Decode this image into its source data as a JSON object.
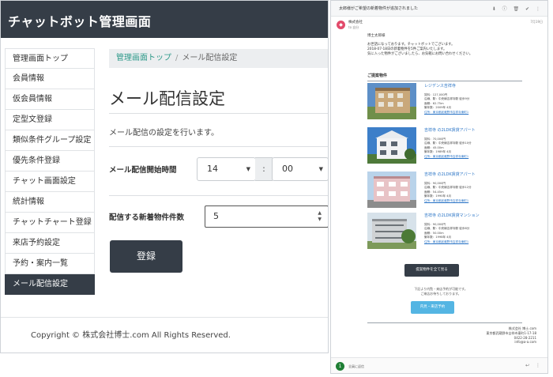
{
  "admin": {
    "title": "チャットボット管理画面",
    "sidebar": {
      "items": [
        {
          "label": "管理画面トップ"
        },
        {
          "label": "会員情報"
        },
        {
          "label": "仮会員情報"
        },
        {
          "label": "定型文登録"
        },
        {
          "label": "類似条件グループ設定"
        },
        {
          "label": "優先条件登録"
        },
        {
          "label": "チャット画面設定"
        },
        {
          "label": "統計情報"
        },
        {
          "label": "チャットチャート登録"
        },
        {
          "label": "来店予約設定"
        },
        {
          "label": "予約・案内一覧"
        },
        {
          "label": "メール配信設定"
        }
      ],
      "active_index": 11
    },
    "breadcrumb": {
      "home": "管理画面トップ",
      "separator": "/",
      "current": "メール配信設定"
    },
    "page_title": "メール配信設定",
    "description": "メール配信の設定を行います。",
    "form": {
      "start_time_label": "メール配信開始時間",
      "hour": "14",
      "colon": ":",
      "minute": "00",
      "count_label": "配信する新着物件件数",
      "count_value": "5"
    },
    "register_button": "登録",
    "copyright": "Copyright © 株式会社博士.com All Rights Reserved."
  },
  "email": {
    "subject": "太郎様がご希望の新着物件が追加されました",
    "from": "株式会社",
    "to": "to 自分",
    "date": "7月19日",
    "salutation": "博士太郎様",
    "body_lines": [
      "お世話になっております。チャットボットでございます。",
      "2018-07-18日の新着物件を5件ご案内いたします。",
      "気に入った物件がございましたら、お気軽にお問い合わせください。"
    ],
    "section_title": "ご提案物件",
    "properties": [
      {
        "name": "レジデンス吉祥寺",
        "details": [
          "賃料：127,000円",
          "沿線、駅：中央線吉祥寺駅 徒歩9分",
          "面積：62.75m",
          "築年数：2009年 4月"
        ],
        "address": "住所：東京都武蔵野市吉祥寺東町1"
      },
      {
        "name": "吉祥寺 の2LDK賃貸アパート",
        "details": [
          "賃料：70,000円",
          "沿線、駅：中央線吉祥寺駅 徒歩10分",
          "面積：45.00m",
          "築年数：1989年 4月"
        ],
        "address": "住所：東京都武蔵野市吉祥寺東町1"
      },
      {
        "name": "吉祥寺 の2LDK賃貸アパート",
        "details": [
          "賃料：90,000円",
          "沿線、駅：中央線吉祥寺駅 徒歩12分",
          "面積：54.45m",
          "築年数：1990年 4月"
        ],
        "address": "住所：東京都武蔵野市吉祥寺東町1"
      },
      {
        "name": "吉祥寺 の2LDK賃貸マンション",
        "details": [
          "賃料：90,000円",
          "沿線、駅：中央線吉祥寺駅 徒歩8分",
          "面積：50.00m",
          "築年数：1998年 4月"
        ],
        "address": "住所：東京都武蔵野市吉祥寺東町1"
      }
    ],
    "all_button": "提案物件を全て見る",
    "note_lines": [
      "下記より内覧・来店予約が可能です。",
      "ご来店お待ちしております。"
    ],
    "reserve_button": "内見・来店予約",
    "company_lines": [
      "株式会社 博士.com",
      "東京都武蔵野市吉祥寺東町1-17-18",
      "0422-28-2211",
      "info@a-a.com"
    ],
    "reply_label": "全員に返信",
    "count": "1"
  }
}
